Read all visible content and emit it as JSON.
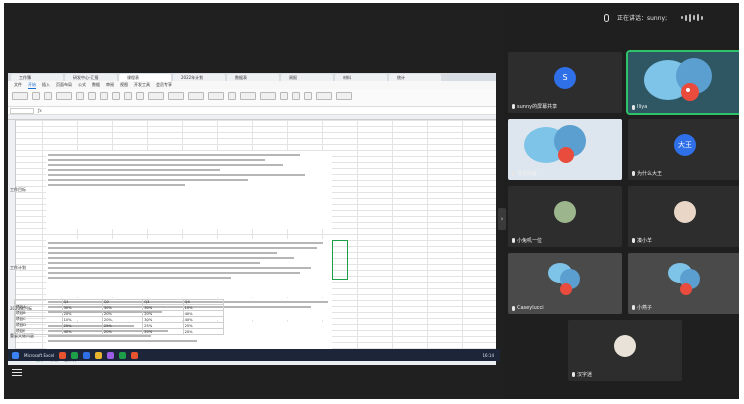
{
  "speaking": {
    "label": "正在讲话：sunny;"
  },
  "colors": {
    "accent_green": "#2ec26b",
    "sheet_green": "#1f9e4a",
    "avatar_blue": "#2f6fe8",
    "taskbar": "#1c2638"
  },
  "doc_tabs": [
    {
      "label": "工作簿",
      "color": "#1f9e4a"
    },
    {
      "label": "研发中心-汇报",
      "color": "#1f9e4a"
    },
    {
      "label": "课程表",
      "color": "#2f6fe8"
    },
    {
      "label": "2022年计划",
      "color": "#e8532f"
    },
    {
      "label": "数据表",
      "color": "#1f9e4a"
    },
    {
      "label": "周报",
      "color": "#e8532f"
    },
    {
      "label": "材料",
      "color": "#2f6fe8"
    },
    {
      "label": "统计",
      "color": "#e8532f"
    }
  ],
  "ribbon_tabs": [
    "文件",
    "开始",
    "插入",
    "页面布局",
    "公式",
    "数据",
    "审阅",
    "视图",
    "开发工具",
    "会员专享"
  ],
  "rows": [
    {
      "label": "工作目标"
    },
    {
      "label": "工作计划"
    },
    {
      "label": "2023年目标"
    },
    {
      "label": "重要关键问题"
    }
  ],
  "mini_table": {
    "header": [
      "",
      "Q1",
      "Q2",
      "Q3",
      "Q4"
    ],
    "rows": [
      [
        "项目A",
        "30%",
        "30%",
        "30%",
        "10%"
      ],
      [
        "项目B",
        "20%",
        "20%",
        "20%",
        "40%"
      ],
      [
        "项目C",
        "10%",
        "20%",
        "30%",
        "40%"
      ],
      [
        "项目D",
        "25%",
        "25%",
        "25%",
        "25%"
      ],
      [
        "项目E",
        "40%",
        "20%",
        "20%",
        "20%"
      ]
    ]
  },
  "sheet_tabs": [
    "Sheet1",
    "目标",
    "计划",
    "工作表"
  ],
  "taskbar": {
    "app_label": "Microsoft Excel",
    "clock": "16:14"
  },
  "tiles": [
    {
      "name": "sunny的屏幕共享",
      "initial": "S",
      "kind": "letter",
      "bg": "#2f6fe8"
    },
    {
      "name": "Iliya",
      "kind": "bird",
      "highlight": true
    },
    {
      "name": "雪花剑客",
      "kind": "bird"
    },
    {
      "name": "为什么大王",
      "initial": "大王",
      "kind": "letter",
      "bg": "#2f6fe8"
    },
    {
      "name": "小兔叽一位",
      "kind": "photo"
    },
    {
      "name": "凑小羊",
      "kind": "photo"
    },
    {
      "name": "Caseylucci",
      "kind": "bird"
    },
    {
      "name": "小燕子",
      "kind": "bird"
    },
    {
      "name": "汉字迷",
      "kind": "photo"
    }
  ]
}
